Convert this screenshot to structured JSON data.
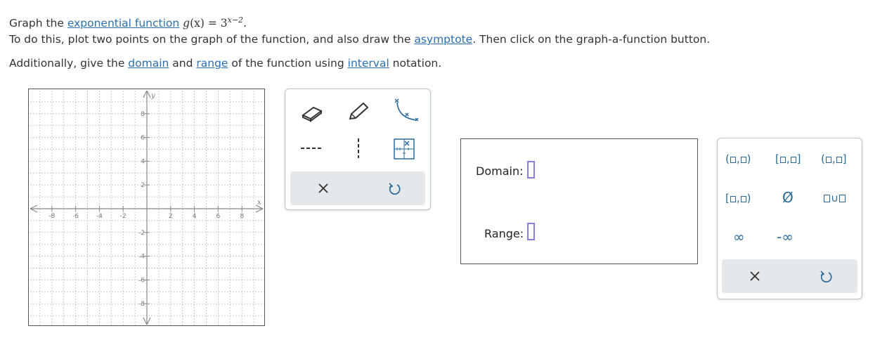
{
  "question": {
    "line1_prefix": "Graph the ",
    "line1_link": "exponential function",
    "function_lhs": "g",
    "function_arg": "(x)",
    "equals": " = 3",
    "exponent": "x−2",
    "line1_end": ".",
    "line2_prefix": "To do this, plot two points on the graph of the function, and also draw the ",
    "line2_link": "asymptote",
    "line2_suffix": ". Then click on the graph-a-function button.",
    "line3_prefix": "Additionally, give the ",
    "line3_link1": "domain",
    "line3_mid1": " and ",
    "line3_link2": "range",
    "line3_mid2": " of the function using ",
    "line3_link3": "interval",
    "line3_suffix": " notation."
  },
  "graph": {
    "x_axis_label": "x",
    "y_axis_label": "y",
    "x_ticks": [
      "-8",
      "-6",
      "-4",
      "-2",
      "2",
      "4",
      "6",
      "8"
    ],
    "y_ticks": [
      "8",
      "6",
      "4",
      "2",
      "-2",
      "-4",
      "-6",
      "-8"
    ],
    "x_range": [
      -10,
      10
    ],
    "y_range": [
      -10,
      10
    ],
    "grid": true
  },
  "graph_tools": {
    "top_row": [
      "eraser-tool",
      "pencil-tool",
      "graph-a-function-tool"
    ],
    "middle_row": [
      "asymptote-horizontal-tool",
      "asymptote-vertical-tool",
      "graph-settings-tool"
    ],
    "bottom_row": [
      "clear-button",
      "undo-button"
    ]
  },
  "answer": {
    "domain_label": "Domain:",
    "range_label": "Range:",
    "domain_value": "",
    "range_value": ""
  },
  "interval_palette": {
    "row1": [
      {
        "open": "(",
        "sep": ",",
        "close": ")"
      },
      {
        "open": "[",
        "sep": ",",
        "close": "]"
      },
      {
        "open": "(",
        "sep": ",",
        "close": "]"
      }
    ],
    "row2": [
      {
        "open": "[",
        "sep": ",",
        "close": ")"
      }
    ],
    "empty_set": "Ø",
    "union": "∪",
    "infinity": "∞",
    "neg_infinity": "-∞",
    "clear": "×",
    "undo": "↺"
  },
  "colors": {
    "link": "#2a6fb0",
    "palette": "#2a6a9a",
    "input_border": "#8c7cd6",
    "toolbar_bg": "#e4e8ea"
  }
}
